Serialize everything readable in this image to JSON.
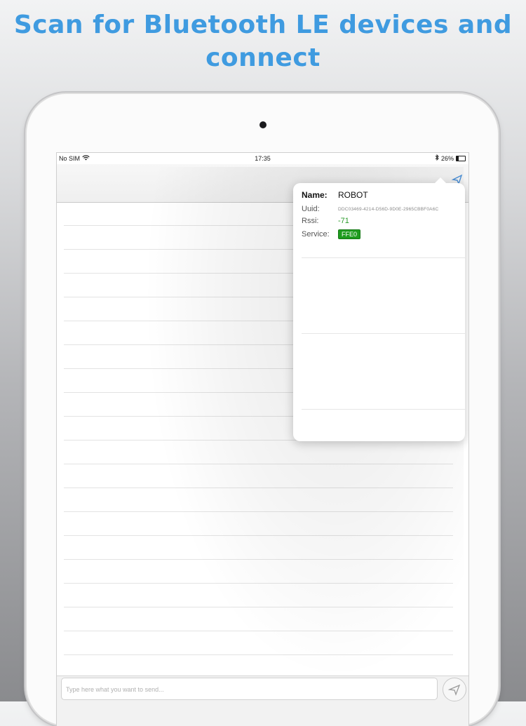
{
  "headline": {
    "line1": "Scan for Bluetooth LE devices and",
    "line2": "connect"
  },
  "status_bar": {
    "carrier": "No SIM",
    "time": "17:35",
    "battery": "26%",
    "battery_level": 0.26
  },
  "device": {
    "name_label": "Name:",
    "name_value": "ROBOT",
    "uuid_label": "Uuid:",
    "uuid_value": "DDC03469-4214-D56D-9D0E-2965CBBF0A6C",
    "rssi_label": "Rssi:",
    "rssi_value": "-71",
    "service_label": "Service:",
    "service_value": "FFE0"
  },
  "composer": {
    "placeholder": "Type here what you want to send..."
  },
  "colors": {
    "headline": "#3f9be0",
    "rssi": "#2a9a2a",
    "service_badge": "#1e9b1e"
  },
  "icons": [
    "wifi-icon",
    "bluetooth-icon",
    "battery-icon",
    "scan-icon",
    "send-icon"
  ]
}
